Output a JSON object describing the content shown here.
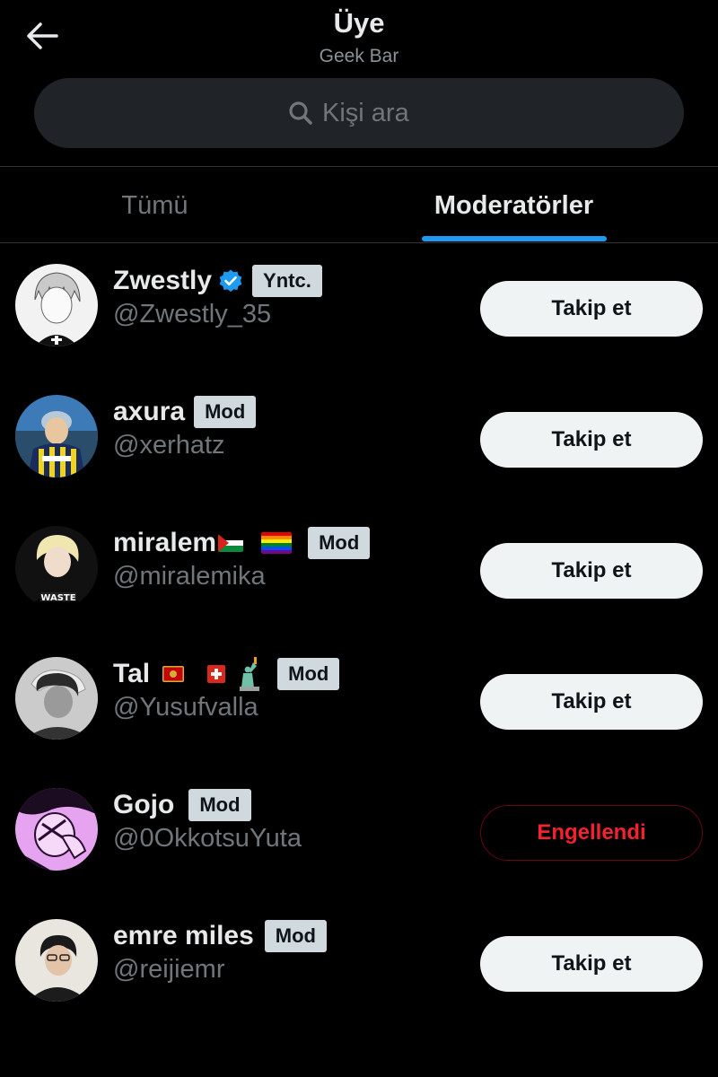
{
  "header": {
    "title": "Üye",
    "subtitle": "Geek Bar",
    "search_placeholder": "Kişi ara"
  },
  "tabs": [
    {
      "label": "Tümü",
      "active": false
    },
    {
      "label": "Moderatörler",
      "active": true
    }
  ],
  "colors": {
    "accent": "#1d9bf0",
    "blocked": "#f4212e",
    "badge_bg": "#cfd9de"
  },
  "members": [
    {
      "name": "Zwestly",
      "handle": "@Zwestly_35",
      "badge": "Yntc.",
      "verified": true,
      "emojis": [],
      "action": "Takip et"
    },
    {
      "name": "axura",
      "handle": "@xerhatz",
      "badge": "Mod",
      "emojis": [],
      "action": "Takip et"
    },
    {
      "name": "miralem",
      "handle": "@miralemika",
      "badge": "Mod",
      "emojis": [
        "palestine-flag",
        "rainbow-flag"
      ],
      "action": "Takip et"
    },
    {
      "name": "Tal",
      "handle": "@Yusufvalla",
      "badge": "Mod",
      "emojis": [
        "montenegro-flag",
        "switzerland-flag",
        "statue-of-liberty"
      ],
      "action": "Takip et"
    },
    {
      "name": "Gojo",
      "handle": "@0OkkotsuYuta",
      "badge": "Mod",
      "emojis": [],
      "action": "Engellendi",
      "blocked": true
    },
    {
      "name": "emre miles",
      "handle": "@reijiemr",
      "badge": "Mod",
      "emojis": [],
      "action": "Takip et"
    }
  ]
}
